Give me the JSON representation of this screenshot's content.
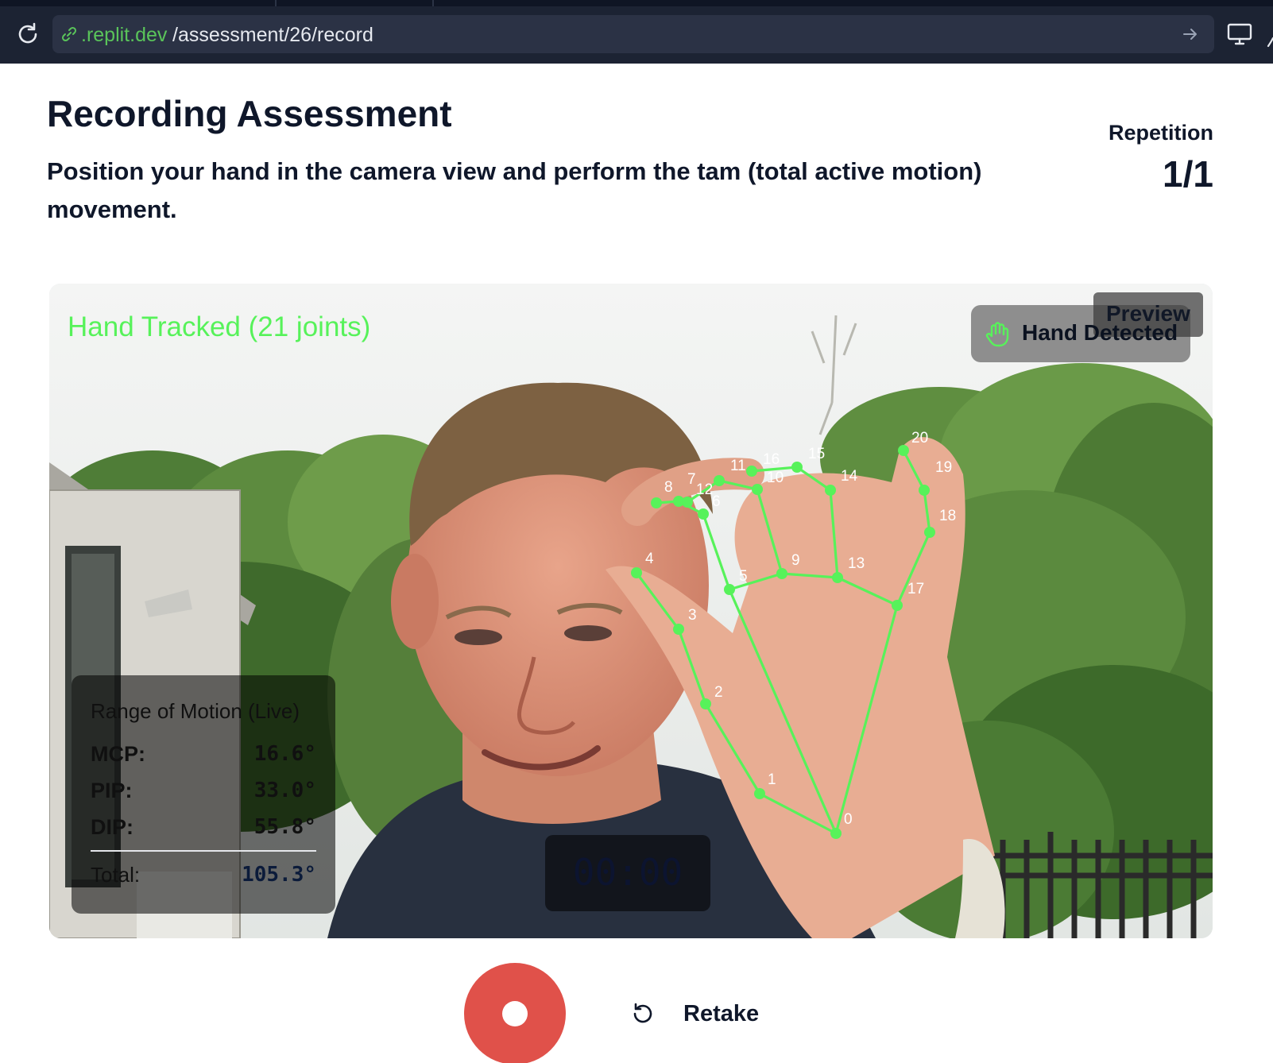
{
  "browser": {
    "url_domain": ".replit.dev",
    "url_path": "/assessment/26/record"
  },
  "header": {
    "title": "Recording Assessment",
    "instructions": "Position your hand in the camera view and perform the tam (total active motion) movement.",
    "repetition_label": "Repetition",
    "repetition_value": "1/1"
  },
  "camera": {
    "tracked_label": "Hand Tracked (21 joints)",
    "preview_label": "Preview",
    "detected_label": "Hand Detected",
    "joint_labels": [
      "0",
      "1",
      "2",
      "3",
      "4",
      "5",
      "6",
      "7",
      "8",
      "9",
      "10",
      "11",
      "12",
      "13",
      "14",
      "15",
      "16",
      "17",
      "18",
      "19",
      "20"
    ],
    "overlay_color": "#57f25a",
    "rom": {
      "title": "Range of Motion (Live)",
      "rows": [
        {
          "key": "MCP:",
          "value": "16.6°"
        },
        {
          "key": "PIP:",
          "value": "33.0°"
        },
        {
          "key": "DIP:",
          "value": "55.8°"
        }
      ],
      "total_key": "Total:",
      "total_value": "105.3°"
    },
    "timer": "00:00"
  },
  "controls": {
    "record_color": "#e0514a",
    "retake_label": "Retake"
  }
}
